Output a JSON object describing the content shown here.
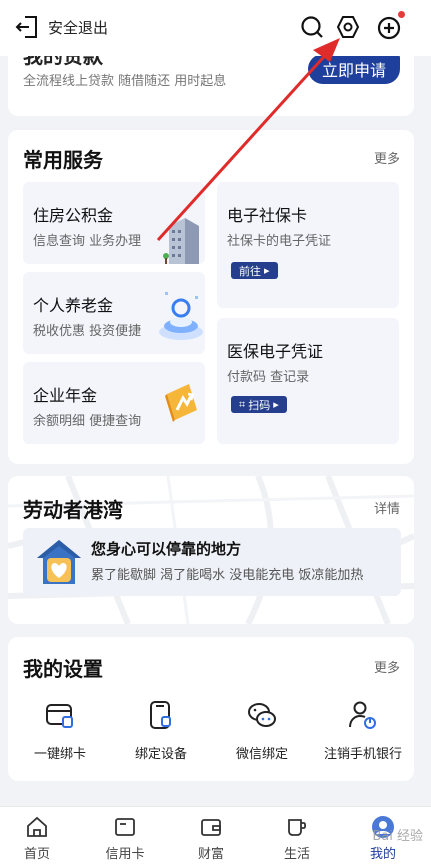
{
  "topbar": {
    "logout_label": "安全退出",
    "icons": [
      "logout-icon",
      "search-icon",
      "settings-hex-icon",
      "add-circle-icon"
    ],
    "notification_dot_color": "#e63b3b"
  },
  "loan": {
    "title": "我的贷款",
    "subtitle": "全流程线上贷款 随借随还 用时起息",
    "apply_label": "立即申请"
  },
  "services": {
    "title": "常用服务",
    "more_label": "更多",
    "tiles": [
      {
        "title": "住房公积金",
        "subtitle": "信息查询 业务办理"
      },
      {
        "title": "个人养老金",
        "subtitle": "税收优惠 投资便捷"
      },
      {
        "title": "企业年金",
        "subtitle": "余额明细 便捷查询"
      },
      {
        "title": "电子社保卡",
        "subtitle": "社保卡的电子凭证",
        "button": "前往"
      },
      {
        "title": "医保电子凭证",
        "subtitle": "付款码 查记录",
        "button": "扫码"
      }
    ]
  },
  "harbor": {
    "title": "劳动者港湾",
    "more_label": "详情",
    "item_title": "您身心可以停靠的地方",
    "item_subtitle": "累了能歇脚 渴了能喝水 没电能充电 饭凉能加热"
  },
  "settings": {
    "title": "我的设置",
    "more_label": "更多",
    "items": [
      {
        "label": "一键绑卡",
        "icon": "card-bind-icon"
      },
      {
        "label": "绑定设备",
        "icon": "device-bind-icon"
      },
      {
        "label": "微信绑定",
        "icon": "wechat-icon"
      },
      {
        "label": "注销手机银行",
        "icon": "user-logout-icon"
      }
    ]
  },
  "bottom_nav": {
    "items": [
      {
        "label": "首页",
        "icon": "home-icon"
      },
      {
        "label": "信用卡",
        "icon": "credit-card-icon"
      },
      {
        "label": "财富",
        "icon": "wallet-icon"
      },
      {
        "label": "生活",
        "icon": "cup-icon"
      },
      {
        "label": "我的",
        "icon": "profile-icon"
      }
    ],
    "active_index": 4,
    "active_color": "#1f3f9c"
  },
  "watermark": "Bai 经验",
  "colors": {
    "brand": "#1f3f9c",
    "annotation_arrow": "#e02b2b"
  }
}
